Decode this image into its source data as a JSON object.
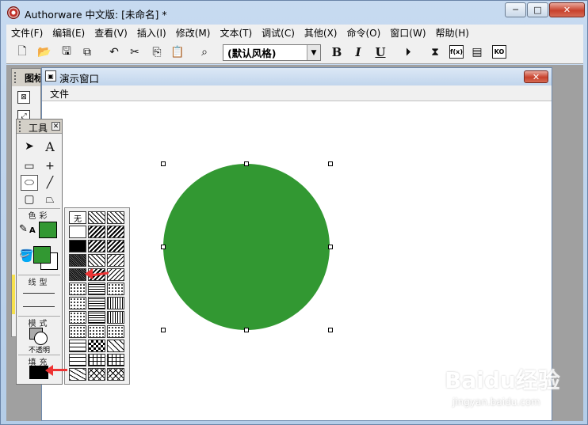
{
  "window": {
    "title": "Authorware 中文版: [未命名] *",
    "minimize": "─",
    "maximize": "□",
    "close": "✕"
  },
  "menu": [
    "文件(F)",
    "编辑(E)",
    "查看(V)",
    "插入(I)",
    "修改(M)",
    "文本(T)",
    "调试(C)",
    "其他(X)",
    "命令(O)",
    "窗口(W)",
    "帮助(H)"
  ],
  "toolbar": {
    "style_value": "(默认风格)",
    "bold": "B",
    "italic": "I",
    "underline": "U",
    "cmd_fn": "f(x)",
    "cmd_ko": "KO"
  },
  "icon_palette": {
    "title": "图标"
  },
  "presentation": {
    "title": "演示窗口",
    "menu_file": "文件",
    "close": "✕",
    "shape_color": "#329832"
  },
  "tools": {
    "title": "工具",
    "close": "✕",
    "color_label": "色彩",
    "line_label": "线型",
    "mode_label": "模式",
    "mode_value": "不透明",
    "fill_label": "填充",
    "stroke_color": "#329832",
    "fill_fg_color": "#329832",
    "fill_bg_color": "#ffffff",
    "pattern_swatch": "#000000"
  },
  "patterns": {
    "none_label": "无"
  },
  "watermark": {
    "main": "Baidu经验",
    "sub": "jingyan.baidu.com"
  }
}
